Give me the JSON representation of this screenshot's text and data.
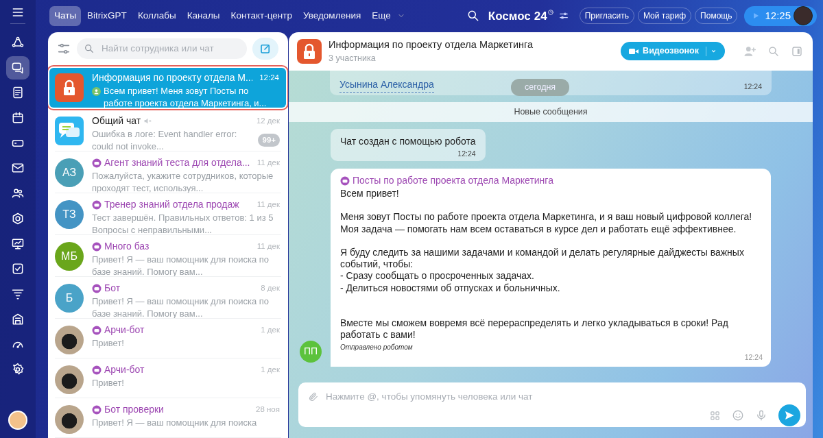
{
  "rail": {
    "items": [
      {
        "selected": false
      },
      {
        "selected": true
      },
      {
        "selected": false
      },
      {
        "selected": false
      },
      {
        "selected": false
      },
      {
        "selected": false
      },
      {
        "selected": false
      },
      {
        "selected": false
      },
      {
        "selected": false
      },
      {
        "selected": false
      },
      {
        "selected": false
      },
      {
        "selected": false
      },
      {
        "selected": false
      },
      {
        "selected": false
      }
    ]
  },
  "topbar": {
    "tabs": [
      {
        "label": "Чаты",
        "selected": true
      },
      {
        "label": "BitrixGPT",
        "selected": false
      },
      {
        "label": "Коллабы",
        "selected": false
      },
      {
        "label": "Каналы",
        "selected": false
      },
      {
        "label": "Контакт-центр",
        "selected": false
      },
      {
        "label": "Уведомления",
        "selected": false
      },
      {
        "label": "Еще",
        "selected": false
      }
    ],
    "logo": "Космос",
    "logo_number": "24",
    "buttons": [
      "Пригласить",
      "Мой тариф",
      "Помощь"
    ],
    "timer": "12:25"
  },
  "chat_list": {
    "search": {
      "placeholder": "Найти сотрудника или чат"
    },
    "items": [
      {
        "title": "Информация по проекту отдела М...",
        "time": "12:24",
        "preview": "Всем привет! Меня зовут Посты по работе проекта отдела Маркетинга, и...",
        "avatar": {
          "kind": "lock",
          "color": "#e4572e"
        },
        "bot": false,
        "muted": false,
        "sender_icon": true,
        "selected": true
      },
      {
        "title": "Общий чат",
        "time": "12 дек",
        "preview": "Ошибка в логе: Event handler error: could not invoke...",
        "avatar": {
          "kind": "chat",
          "color": "#2fb7f0"
        },
        "bot": false,
        "muted": true,
        "sender_icon": false,
        "counter": "99+",
        "selected": false
      },
      {
        "title": "Агент знаний теста для отдела...",
        "time": "11 дек",
        "preview": "Пожалуйста, укажите сотрудников, которые проходят тест, используя...",
        "avatar": {
          "kind": "initials",
          "initials": "АЗ",
          "color": "#4a9fb6"
        },
        "bot": true,
        "muted": false,
        "sender_icon": false,
        "selected": false
      },
      {
        "title": "Тренер знаний отдела продаж",
        "time": "11 дек",
        "preview": "Тест завершён. Правильных ответов: 1 из 5 Вопросы с неправильными...",
        "avatar": {
          "kind": "initials",
          "initials": "ТЗ",
          "color": "#4494c4"
        },
        "bot": true,
        "muted": false,
        "sender_icon": false,
        "selected": false
      },
      {
        "title": "Много баз",
        "time": "11 дек",
        "preview": "Привет! Я — ваш помощник для поиска по базе знаний. Помогу вам...",
        "avatar": {
          "kind": "initials",
          "initials": "МБ",
          "color": "#6aa61b"
        },
        "bot": true,
        "muted": false,
        "sender_icon": false,
        "selected": false
      },
      {
        "title": "Бот",
        "time": "8 дек",
        "preview": "Привет! Я — ваш помощник для поиска по базе знаний. Помогу вам...",
        "avatar": {
          "kind": "initials",
          "initials": "Б",
          "color": "#4aa3c8"
        },
        "bot": true,
        "muted": false,
        "sender_icon": false,
        "selected": false
      },
      {
        "title": "Арчи-бот",
        "time": "1 дек",
        "preview": "Привет!",
        "avatar": {
          "kind": "photo"
        },
        "bot": true,
        "muted": false,
        "sender_icon": false,
        "selected": false
      },
      {
        "title": "Арчи-бот",
        "time": "1 дек",
        "preview": "Привет!",
        "avatar": {
          "kind": "photo"
        },
        "bot": true,
        "muted": false,
        "sender_icon": false,
        "selected": false
      },
      {
        "title": "Бот проверки",
        "time": "28 ноя",
        "preview": "Привет! Я — ваш помощник для поиска",
        "avatar": {
          "kind": "photo"
        },
        "bot": true,
        "muted": false,
        "sender_icon": false,
        "selected": false
      }
    ]
  },
  "chat": {
    "title": "Информация по проекту отдела Маркетинга",
    "subtitle": "3 участника",
    "call_button": "Видеозвонок",
    "previous_message": {
      "link": "Усынина Александра",
      "time": "12:24"
    },
    "date_pill": "сегодня",
    "new_messages": "Новые сообщения",
    "system_message": {
      "text": "Чат создан с помощью робота",
      "time": "12:24"
    },
    "message": {
      "author": "Посты по работе проекта отдела Маркетинга",
      "avatar": {
        "initials": "ПП",
        "color": "#5cc23c"
      },
      "paragraphs": [
        "Всем привет!",
        "Меня зовут Посты по работе проекта отдела Маркетинга, и я ваш новый цифровой коллега!\nМоя задача — помогать нам всем оставаться в курсе дел и работать ещё эффективнее.",
        "Я буду следить за нашими задачами и командой и делать регулярные дайджесты важных событий, чтобы:\n- Сразу сообщать о просроченных задачах.\n- Делиться новостями об отпусках и больничных.",
        "Вместе мы сможем вовремя всё перераспределять и легко укладываться в сроки! Рад работать с вами!"
      ],
      "footnote": "Отправлено роботом",
      "time": "12:24"
    },
    "composer": {
      "placeholder": "Нажмите @, чтобы упомянуть человека или чат"
    }
  }
}
